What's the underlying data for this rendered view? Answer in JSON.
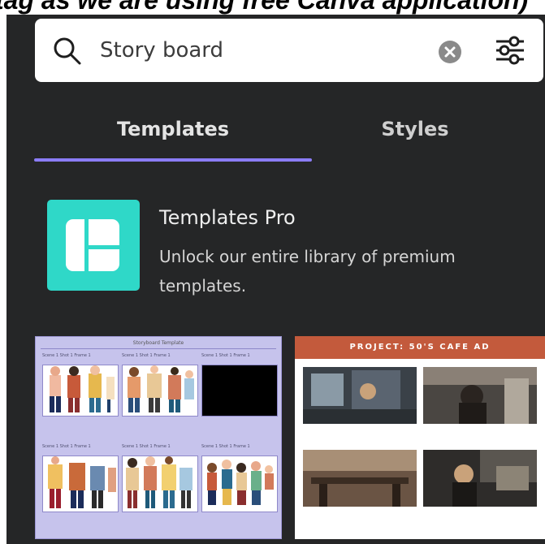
{
  "caption": "tag as we are using free Canva application)",
  "search": {
    "value": "Story board",
    "icons": [
      "search-icon",
      "clear-icon",
      "filter-icon"
    ]
  },
  "tabs": [
    {
      "label": "Templates",
      "active": true
    },
    {
      "label": "Styles",
      "active": false
    }
  ],
  "pro": {
    "title": "Templates Pro",
    "description": "Unlock our entire library of premium templates."
  },
  "thumbnails": {
    "storyboard": {
      "title": "Storyboard Template",
      "meta": "Scene 1   Shot 1   Frame 1"
    },
    "moodboard": {
      "title": "PROJECT: 50'S CAFE AD"
    }
  },
  "colors": {
    "panel": "#252627",
    "accent": "#8b7cf6",
    "pro_logo": "#2fd8c8",
    "moodboard_header": "#c35a3c",
    "storyboard_bg": "#c6c3ec"
  }
}
